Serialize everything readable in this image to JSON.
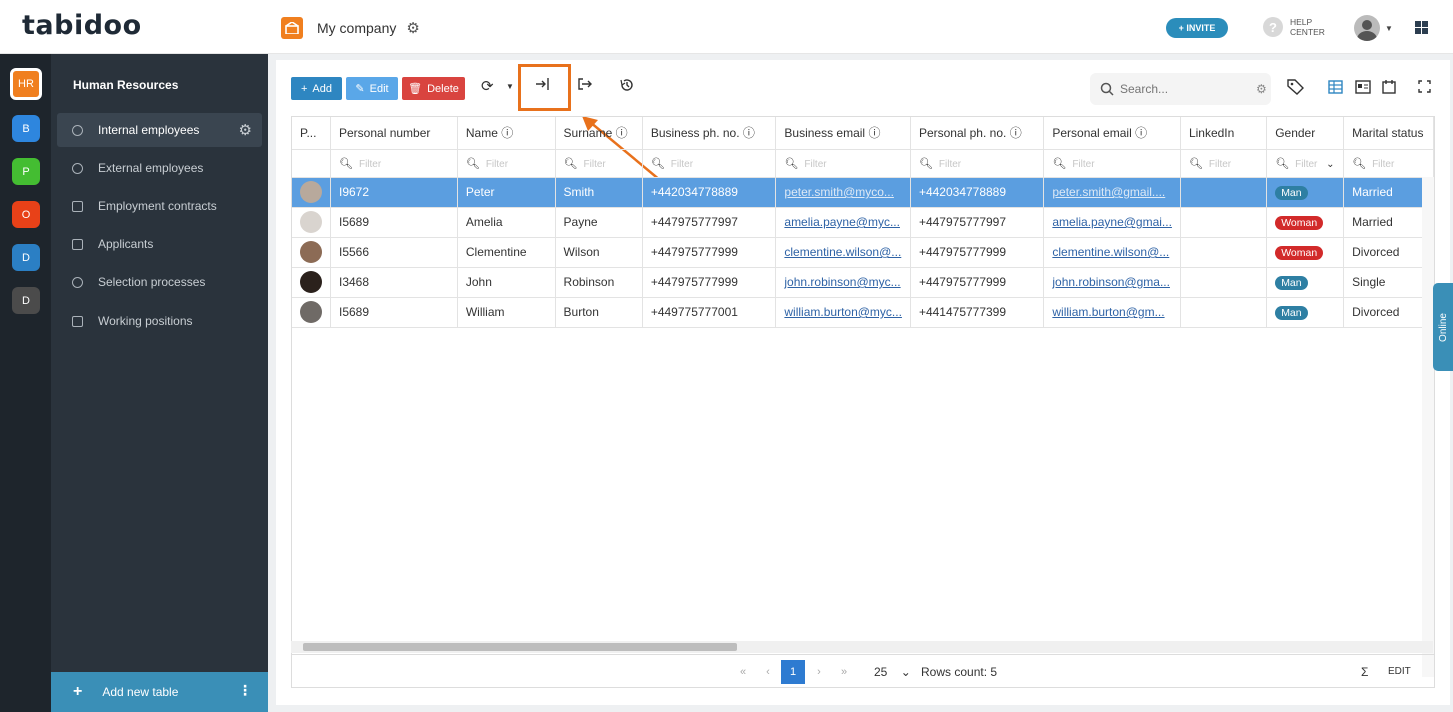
{
  "header": {
    "logo": "tabidoo",
    "company": "My company",
    "invite": "+ INVITE",
    "help_line1": "HELP",
    "help_line2": "CENTER"
  },
  "apps": [
    {
      "label": "HR",
      "color": "#f07f1f",
      "active": true
    },
    {
      "label": "B",
      "color": "#2e86de"
    },
    {
      "label": "P",
      "color": "#44bd32"
    },
    {
      "label": "O",
      "color": "#e84118"
    },
    {
      "label": "D",
      "color": "#2b7fc4"
    },
    {
      "label": "D",
      "color": "#4b4b4b"
    }
  ],
  "sidebar": {
    "title": "Human Resources",
    "items": [
      {
        "label": "Internal employees",
        "active": true
      },
      {
        "label": "External employees"
      },
      {
        "label": "Employment contracts"
      },
      {
        "label": "Applicants"
      },
      {
        "label": "Selection processes"
      },
      {
        "label": "Working positions"
      }
    ],
    "add_table": "Add new table"
  },
  "toolbar": {
    "add": "Add",
    "edit": "Edit",
    "delete": "Delete",
    "search_placeholder": "Search..."
  },
  "table": {
    "columns": [
      "P...",
      "Personal number",
      "Name",
      "Surname",
      "Business ph. no.",
      "Business email",
      "Personal ph. no.",
      "Personal email",
      "LinkedIn",
      "Gender",
      "Marital status"
    ],
    "filter_placeholder": "Filter",
    "rows": [
      {
        "number": "I9672",
        "name": "Peter",
        "surname": "Smith",
        "bphone": "+442034778889",
        "bemail": "peter.smith@myco...",
        "pphone": "+442034778889",
        "pemail": "peter.smith@gmail....",
        "linkedin": "",
        "gender": "Man",
        "marital": "Married",
        "selected": true
      },
      {
        "number": "I5689",
        "name": "Amelia",
        "surname": "Payne",
        "bphone": "+447975777997",
        "bemail": "amelia.payne@myc...",
        "pphone": "+447975777997",
        "pemail": "amelia.payne@gmai...",
        "linkedin": "",
        "gender": "Woman",
        "marital": "Married"
      },
      {
        "number": "I5566",
        "name": "Clementine",
        "surname": "Wilson",
        "bphone": "+447975777999",
        "bemail": "clementine.wilson@...",
        "pphone": "+447975777999",
        "pemail": "clementine.wilson@...",
        "linkedin": "",
        "gender": "Woman",
        "marital": "Divorced"
      },
      {
        "number": "I3468",
        "name": "John",
        "surname": "Robinson",
        "bphone": "+447975777999",
        "bemail": "john.robinson@myc...",
        "pphone": "+447975777999",
        "pemail": "john.robinson@gma...",
        "linkedin": "",
        "gender": "Man",
        "marital": "Single"
      },
      {
        "number": "I5689",
        "name": "William",
        "surname": "Burton",
        "bphone": "+449775777001",
        "bemail": "william.burton@myc...",
        "pphone": "+441475777399",
        "pemail": "william.burton@gm...",
        "linkedin": "",
        "gender": "Man",
        "marital": "Divorced"
      }
    ]
  },
  "pager": {
    "current": "1",
    "page_size": "25",
    "rows_count": "Rows count: 5",
    "sigma": "Σ",
    "edit": "EDIT"
  },
  "online": "Online"
}
